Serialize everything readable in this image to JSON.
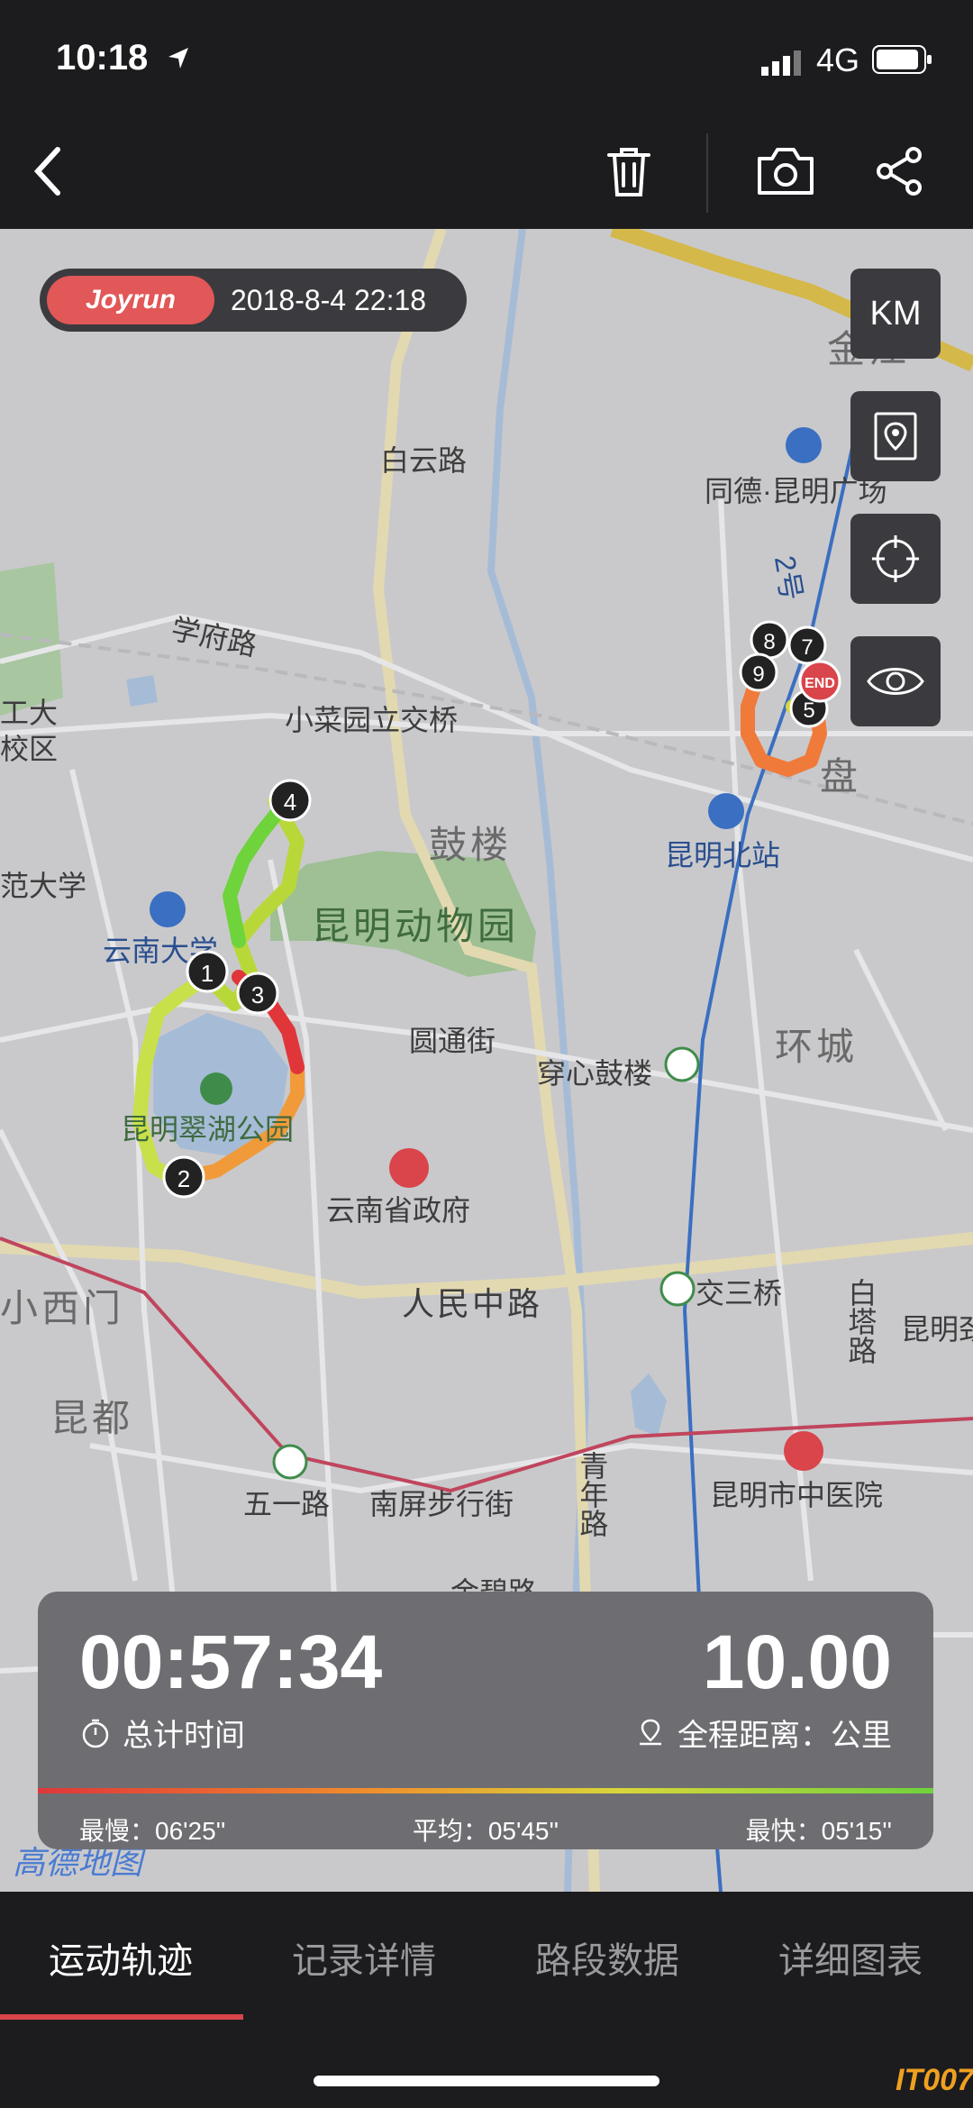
{
  "status_bar": {
    "time": "10:18",
    "network": "4G"
  },
  "toolbar": {
    "back": "back",
    "delete": "delete",
    "camera": "camera",
    "share": "share"
  },
  "header": {
    "brand": "Joyrun",
    "datetime": "2018-8-4 22:18"
  },
  "side_buttons": {
    "unit": "KM"
  },
  "map_labels": {
    "baiyun_road": "白云路",
    "xuefu_road": "学府路",
    "xiaocaiyuan": "小菜园立交桥",
    "gulou": "鼓楼",
    "zoo": "昆明动物园",
    "yunnan_univ": "云南大学",
    "yuantong_st": "圆通街",
    "chuanxin_gulou": "穿心鼓楼",
    "huancheng": "环城",
    "cuihu_park": "昆明翠湖公园",
    "provincial_gov": "云南省政府",
    "renmin_mid_road": "人民中路",
    "jiaosanqiao": "交三桥",
    "baita_road": "白塔路",
    "xiaoximen": "小西门",
    "kundu": "昆都",
    "wuyi_road": "五一路",
    "nanping_street": "南屏步行街",
    "qingnian_road": "青年路",
    "kunming_tcm": "昆明市中医院",
    "kunming_north": "昆明北站",
    "tongde": "同德·昆明广场",
    "jinjiang": "金江",
    "line2": "2号",
    "kunming_edge": "昆明劲",
    "jinbi_road": "金碧路",
    "university_left": "工大",
    "school_left": "校区",
    "fan_univ": "范大学",
    "panlong": "盘",
    "gaode": "高德地图"
  },
  "markers": [
    "1",
    "2",
    "3",
    "4",
    "5",
    "7",
    "8",
    "9",
    "END"
  ],
  "stats": {
    "duration": "00:57:34",
    "duration_label": "总计时间",
    "distance": "10.00",
    "distance_label": "全程距离：公里",
    "slowest": "最慢：06'25''",
    "average": "平均：05'45''",
    "fastest": "最快：05'15''"
  },
  "tabs": [
    "运动轨迹",
    "记录详情",
    "路段数据",
    "详细图表"
  ],
  "watermark": "IT007",
  "colors": {
    "accent": "#d9454a",
    "brand": "#e25757",
    "route_fast": "#6fd33c",
    "route_slow": "#e0363a"
  }
}
